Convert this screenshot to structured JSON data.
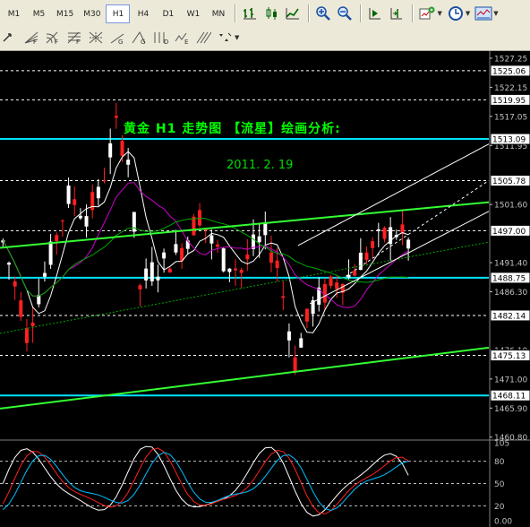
{
  "toolbar": {
    "timeframes": [
      "M1",
      "M5",
      "M15",
      "M30",
      "H1",
      "H4",
      "D1",
      "W1",
      "MN"
    ],
    "active_timeframe": "H1",
    "icons_row1": [
      "bar-chart-icon",
      "candlestick-icon",
      "line-chart-icon",
      "zoom-in-icon",
      "zoom-out-icon",
      "auto-scroll-icon",
      "chart-shift-icon",
      "indicators-icon",
      "periods-icon",
      "templates-icon"
    ],
    "icons_row2": [
      "arrow-tool-icon",
      "fibonacci-fan-icon",
      "fibonacci-arcs-icon",
      "fibonacci-grid-icon",
      "gann-line-icon",
      "gann-fan-icon",
      "gann-grid-icon",
      "cycle-lines-icon",
      "elliott-wave-icon",
      "pitchfork-icon",
      "arrow-marks-icon"
    ]
  },
  "chart_data": {
    "type": "candlestick",
    "title": "黄金  H1  走势图  【流星】绘画分析:",
    "date_label": "2011. 2. 19",
    "colors": {
      "background": "#000000",
      "bull_candle": "#ffffff",
      "bear_candle": "#ff2020",
      "ma_fast": "#ffffff",
      "ma_mid": "#cc00cc",
      "ma_slow": "#00aa00",
      "horizontal_levels": "#00e5ff",
      "trend_lines": "#33ff33",
      "channel_lines": "#ffffff",
      "dotted_grid": "#ffffff",
      "osc_main": "#ffffff",
      "osc_signal": "#ff2020",
      "osc_third": "#00bfff"
    },
    "price_axis": {
      "range": [
        1460.6,
        1528.5
      ],
      "tick_labels": [
        "1527.25",
        "1522.15",
        "1517.05",
        "1511.95",
        "1501.60",
        "1491.40",
        "1486.30",
        "1476.10",
        "1471.00",
        "1465.90",
        "1460.80"
      ]
    },
    "highlighted_levels": [
      {
        "label": "1525.06",
        "value": 1525.06,
        "style": "dotted"
      },
      {
        "label": "1519.95",
        "value": 1519.95,
        "style": "dotted"
      },
      {
        "label": "1513.09",
        "value": 1513.09,
        "style": "solid"
      },
      {
        "label": "1505.78",
        "value": 1505.78,
        "style": "dotted"
      },
      {
        "label": "1497.00",
        "value": 1497.0,
        "style": "dotted"
      },
      {
        "label": "1488.75",
        "value": 1488.75,
        "style": "solid"
      },
      {
        "label": "1482.14",
        "value": 1482.14,
        "style": "dotted"
      },
      {
        "label": "1475.13",
        "value": 1475.13,
        "style": "dotted"
      },
      {
        "label": "1468.11",
        "value": 1468.11,
        "style": "solid"
      }
    ],
    "trend_lines": [
      {
        "from": [
          0,
          1494.0
        ],
        "to": [
          82,
          1502.0
        ]
      },
      {
        "from": [
          0,
          1465.8
        ],
        "to": [
          82,
          1476.5
        ]
      }
    ],
    "channel": {
      "upper": {
        "from": [
          50,
          1494.4
        ],
        "to": [
          82,
          1512.2
        ]
      },
      "mid": {
        "from": [
          58,
          1489.0
        ],
        "to": [
          82,
          1505.8
        ]
      },
      "lower": {
        "from": [
          52,
          1484.2
        ],
        "to": [
          82,
          1500.4
        ]
      }
    },
    "oscillator": {
      "tick_labels": [
        "105",
        "80",
        "50",
        "20",
        "0.00"
      ],
      "range": [
        -5,
        105
      ],
      "levels": [
        80,
        50,
        20
      ]
    },
    "candles_count": 69
  }
}
